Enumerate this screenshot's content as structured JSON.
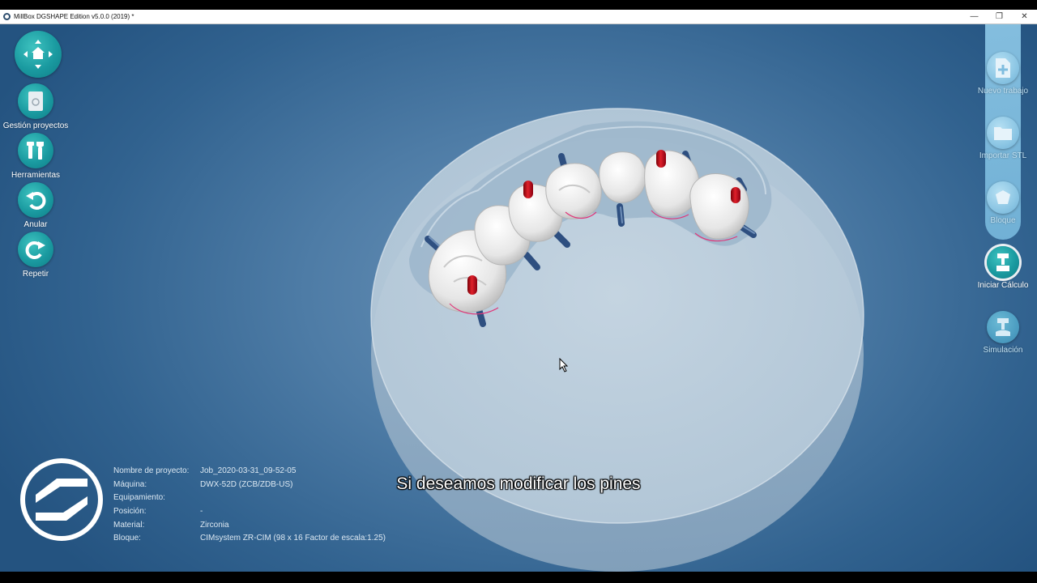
{
  "window": {
    "title": "MillBox DGSHAPE Edition v5.0.0 (2019) *",
    "controls": {
      "minimize": "—",
      "restore": "❐",
      "close": "✕"
    }
  },
  "left_toolbar": [
    {
      "id": "navigation",
      "label": "",
      "icon": "home-navigation-icon"
    },
    {
      "id": "projects",
      "label": "Gestión proyectos",
      "icon": "project-management-icon"
    },
    {
      "id": "tools",
      "label": "Herramientas",
      "icon": "tools-icon"
    },
    {
      "id": "undo",
      "label": "Anular",
      "icon": "undo-icon"
    },
    {
      "id": "redo",
      "label": "Repetir",
      "icon": "redo-icon"
    }
  ],
  "right_toolbar": [
    {
      "id": "new",
      "label": "Nuevo trabajo",
      "icon": "new-document-icon",
      "state": "inactive"
    },
    {
      "id": "import",
      "label": "Importar STL",
      "icon": "folder-icon",
      "state": "inactive"
    },
    {
      "id": "block",
      "label": "Bloque",
      "icon": "block-icon",
      "state": "inactive"
    },
    {
      "id": "calc",
      "label": "Iniciar Cálculo",
      "icon": "mill-calc-icon",
      "state": "active"
    },
    {
      "id": "sim",
      "label": "Simulación",
      "icon": "simulation-icon",
      "state": "normal"
    }
  ],
  "project_info": [
    {
      "key": "Nombre de proyecto:",
      "value": "Job_2020-03-31_09-52-05"
    },
    {
      "key": "Máquina:",
      "value": "DWX-52D (ZCB/ZDB-US)"
    },
    {
      "key": "Equipamiento:",
      "value": ""
    },
    {
      "key": "Posición:",
      "value": "-"
    },
    {
      "key": "Material:",
      "value": "Zirconia"
    },
    {
      "key": "Bloque:",
      "value": "CIMsystem ZR-CIM (98 x 16 Factor de escala:1.25)"
    }
  ],
  "subtitle": "Si deseamos modificar los pines",
  "colors": {
    "accent_teal": "#1a9aa0",
    "background_blue": "#3a6b98",
    "block_disc": "#bcd0e0",
    "pin_red": "#c0101a",
    "pin_blue": "#2e4f80"
  }
}
